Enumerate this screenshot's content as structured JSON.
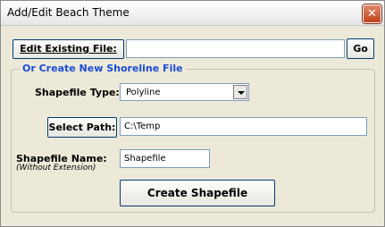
{
  "window": {
    "title": "Add/Edit Beach Theme",
    "close_glyph": "✕"
  },
  "edit_existing": {
    "button_label": "Edit Existing File:",
    "value": "",
    "go_label": "Go"
  },
  "create_group": {
    "title": "Or Create New Shoreline File",
    "shapefile_type_label": "Shapefile Type:",
    "shapefile_type_value": "Polyline",
    "select_path_label": "Select Path:",
    "path_value": "C:\\Temp",
    "shapefile_name_label": "Shapefile Name:",
    "shapefile_name_sub": "(Without Extension)",
    "shapefile_name_value": "Shapefile",
    "create_button_label": "Create Shapefile"
  },
  "colors": {
    "group_title": "#1a4bd6",
    "window_bg": "#ece9d8",
    "close_red": "#c1411b"
  }
}
